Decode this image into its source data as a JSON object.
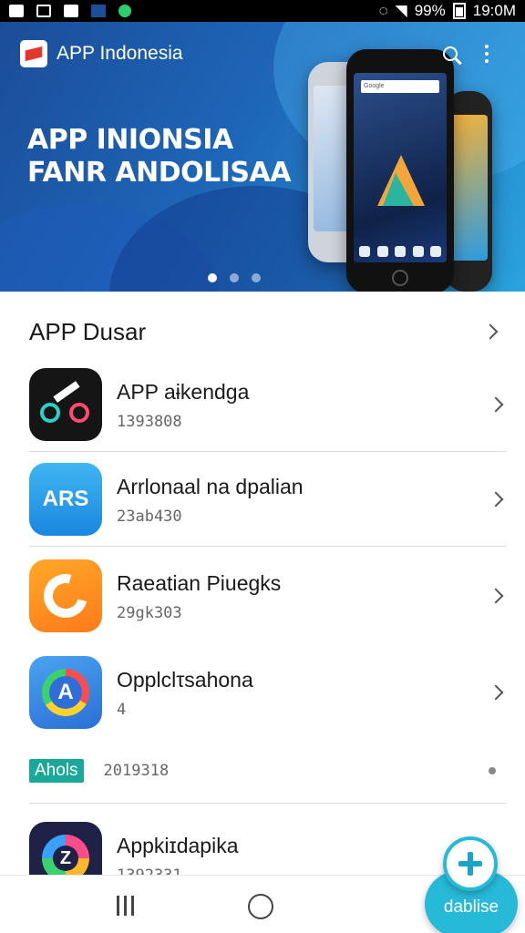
{
  "status_bar": {
    "battery": "99%",
    "time": "19:0M"
  },
  "app_bar": {
    "title": "APP Indonesia"
  },
  "hero": {
    "headline_line1": "APP INIONSIA",
    "headline_line2": "FANR ANDOLISAA",
    "phone_search_text": "Google",
    "carousel_active_index": 1,
    "carousel_count": 3
  },
  "section": {
    "title": "APP Dusar"
  },
  "apps": [
    {
      "title": "APP aɨkendga",
      "subtitle": "1393808",
      "icon": "motorbike-icon"
    },
    {
      "title": "Arrlonaal na dpalian",
      "subtitle": "23ab430",
      "icon": "aks-logo-icon"
    },
    {
      "title": "Raeatian Piuegks",
      "subtitle": "29gk303",
      "icon": "orange-swirl-icon"
    },
    {
      "title": "Opplclτsahona",
      "subtitle": "4",
      "icon": "color-ring-a-icon"
    },
    {
      "title": "Appkiɪdapika",
      "subtitle": "1392331",
      "icon": "color-ring-z-icon"
    }
  ],
  "tag_row": {
    "tag": "Ahols",
    "value": "2019318"
  },
  "fab": {
    "label": "dablise"
  },
  "colors": {
    "accent": "#27b9d8",
    "hero_dark": "#1b4d9a",
    "hero_light": "#2aa3dd",
    "tag": "#1aa89a"
  }
}
